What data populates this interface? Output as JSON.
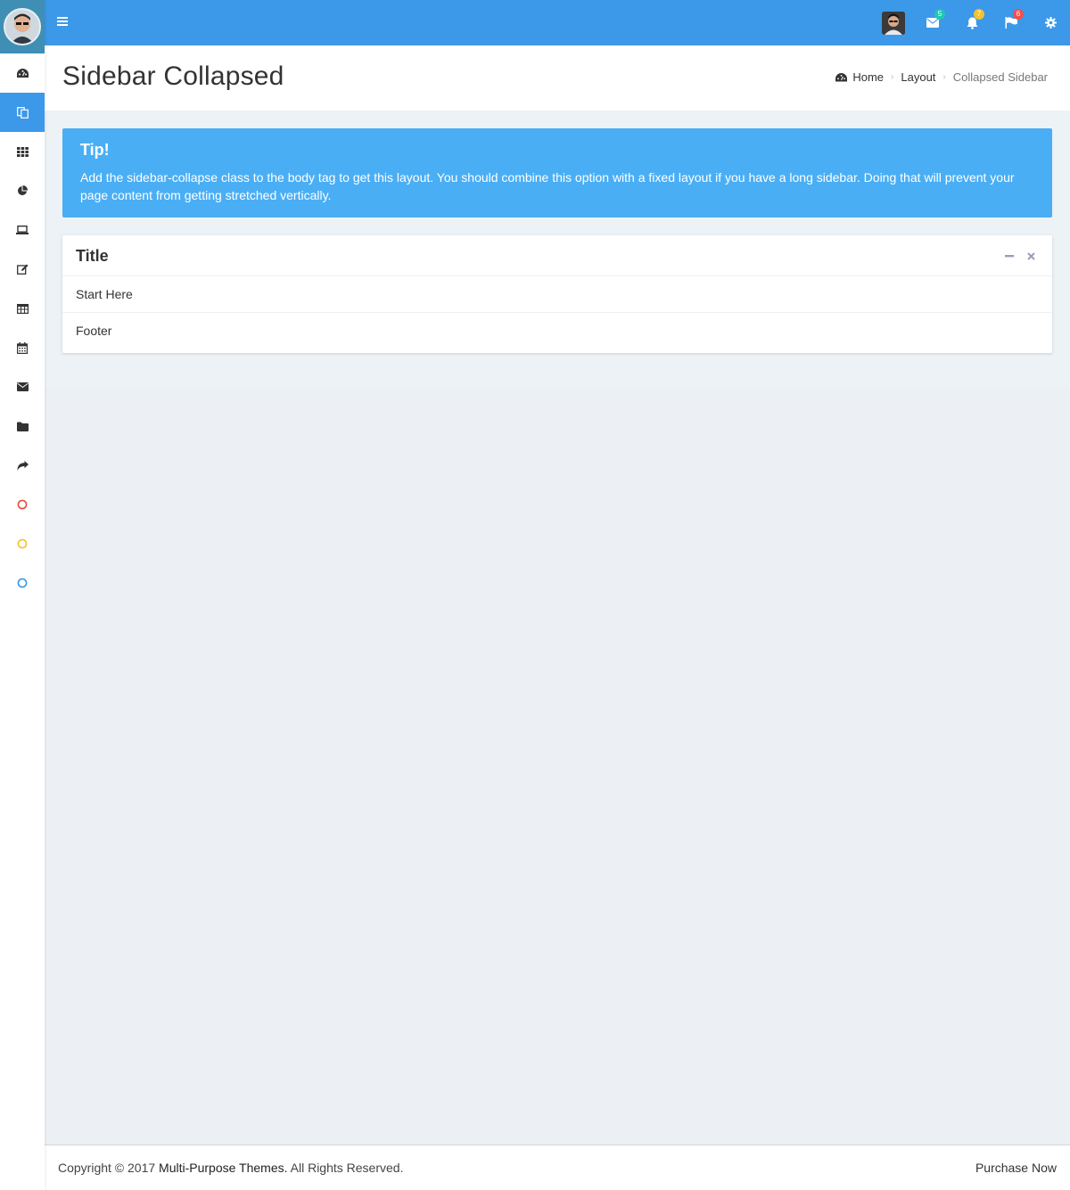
{
  "colors": {
    "primary": "#3c98e8",
    "callout": "#4aaef5",
    "badge_mail": "#1fc8b4",
    "badge_bell": "#f5c12f",
    "badge_flag": "#f0504f",
    "circle_red": "#e84c3d",
    "circle_yellow": "#f5c12f",
    "circle_blue": "#3c98e8"
  },
  "sidebar": {
    "items": [
      {
        "icon": "dashboard-icon",
        "active": false
      },
      {
        "icon": "copy-icon",
        "active": true
      },
      {
        "icon": "grid-icon",
        "active": false
      },
      {
        "icon": "pie-chart-icon",
        "active": false
      },
      {
        "icon": "laptop-icon",
        "active": false
      },
      {
        "icon": "edit-icon",
        "active": false
      },
      {
        "icon": "table-icon",
        "active": false
      },
      {
        "icon": "calendar-icon",
        "active": false
      },
      {
        "icon": "envelope-icon",
        "active": false
      },
      {
        "icon": "folder-icon",
        "active": false
      },
      {
        "icon": "share-icon",
        "active": false
      },
      {
        "icon": "circle-red-icon",
        "active": false
      },
      {
        "icon": "circle-yellow-icon",
        "active": false
      },
      {
        "icon": "circle-blue-icon",
        "active": false
      }
    ]
  },
  "topbar": {
    "badges": {
      "messages": "5",
      "notifications": "7",
      "tasks": "6"
    }
  },
  "header": {
    "title": "Sidebar Collapsed",
    "breadcrumb": {
      "home": "Home",
      "layout": "Layout",
      "current": "Collapsed Sidebar"
    }
  },
  "callout": {
    "title": "Tip!",
    "text": "Add the sidebar-collapse class to the body tag to get this layout. You should combine this option with a fixed layout if you have a long sidebar. Doing that will prevent your page content from getting stretched vertically."
  },
  "box": {
    "title": "Title",
    "body": "Start Here",
    "footer": "Footer"
  },
  "footer": {
    "copyright_prefix": "Copyright © 2017 ",
    "brand": "Multi-Purpose Themes.",
    "copyright_suffix": " All Rights Reserved.",
    "purchase": "Purchase Now"
  }
}
